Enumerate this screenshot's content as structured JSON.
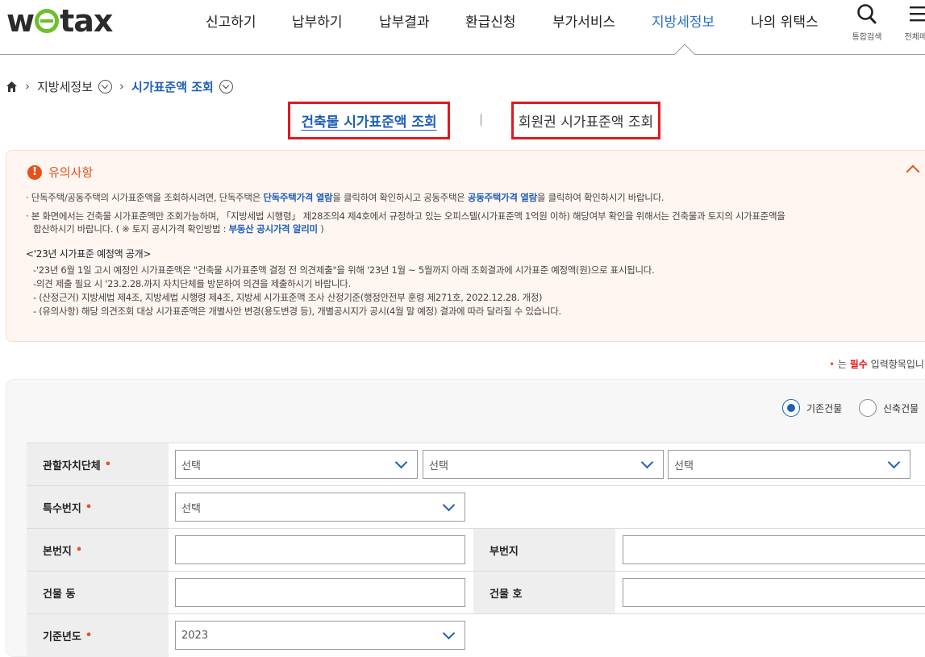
{
  "header": {
    "logo": "wetax",
    "nav": [
      {
        "label": "신고하기"
      },
      {
        "label": "납부하기"
      },
      {
        "label": "납부결과"
      },
      {
        "label": "환급신청"
      },
      {
        "label": "부가서비스"
      },
      {
        "label": "지방세정보",
        "active": true
      },
      {
        "label": "나의 위택스"
      }
    ],
    "search_label": "통합검색",
    "menu_label": "전체메뉴"
  },
  "breadcrumb": {
    "level1": "지방세정보",
    "level2": "시가표준액 조회"
  },
  "tabs": [
    {
      "label": "건축물 시가표준액 조회",
      "active": true
    },
    {
      "label": "회원권 시가표준액 조회",
      "active": false
    }
  ],
  "notice": {
    "title": "유의사항",
    "line1": {
      "pre": "· 단독주택/공동주택의 시가표준액을 조회하시려면, 단독주택은 ",
      "link1": "단독주택가격 열람",
      "mid": "을 클릭하여 확인하시고 공동주택은 ",
      "link2": "공동주택가격 열람",
      "post": "을 클릭하여 확인하시기 바랍니다."
    },
    "line2": "· 본 화면에서는 건축물 시가표준액만 조회가능하며, 「지방세법 시행령」 제28조의4 제4호에서 규정하고 있는 오피스텔(시가표준액 1억원 이하) 해당여부 확인을 위해서는 건축물과 토지의 시가표준액을",
    "line3": {
      "pre": "합산하시기 바랍니다. ( ※ 토지 공시가격 확인방법 : ",
      "link": "부동산 공시가격 알리미",
      "post": " )"
    },
    "section_title": "<'23년 시가표준 예정액 공개>",
    "items": [
      "-'23년 6월 1일 고시 예정인 시가표준액은 \"건축물 시가표준액 결정 전 의견제출\"을 위해 '23년 1월 ~ 5월까지 아래 조회결과에 시가표준 예정액(원)으로 표시됩니다.",
      "-의견 제출 필요 시 '23.2.28.까지 자치단체를 방문하여 의견을 제출하시기 바랍니다.",
      "- (산정근거) 지방세법 제4조, 지방세법 시행령 제4조, 지방세 시가표준액 조사 산정기준(행정안전부 훈령 제271호, 2022.12.28. 개정)",
      "- (유의사항) 해당 의견조회 대상 시가표준액은 개별사안 변경(용도변경 등), 개별공시지가 공시(4월 말 예정) 결과에 따라 달라질 수 있습니다."
    ]
  },
  "required_note": {
    "dot": "•",
    "pre": " 는 ",
    "em": "필수",
    "post": " 입력항목입니다"
  },
  "building_type": {
    "options": [
      {
        "label": "기존건물",
        "selected": true
      },
      {
        "label": "신축건물",
        "selected": false
      }
    ]
  },
  "form": {
    "required_mark": "•",
    "jurisdiction_label": "관할자치단체",
    "jurisdiction_selects": [
      "선택",
      "선택",
      "선택"
    ],
    "special_lot_label": "특수번지",
    "special_lot_value": "선택",
    "main_lot_label": "본번지",
    "main_lot_value": "",
    "sub_lot_label": "부번지",
    "sub_lot_value": "",
    "building_dong_label": "건물 동",
    "building_dong_value": "",
    "building_ho_label": "건물 호",
    "building_ho_value": "",
    "base_year_label": "기준년도",
    "base_year_value": "2023"
  }
}
